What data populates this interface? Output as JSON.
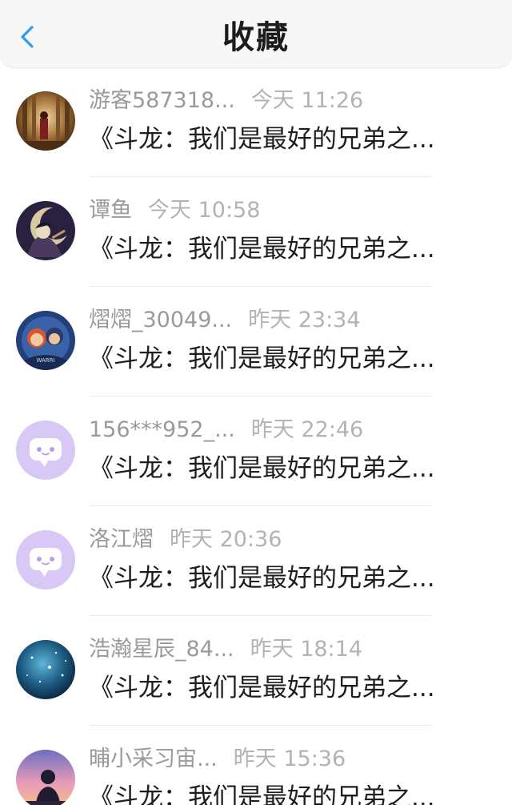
{
  "header": {
    "title": "收藏",
    "back_icon": "chevron-left-icon",
    "accent_color": "#2f9bf0"
  },
  "items": [
    {
      "username": "游客587318...",
      "time": "今天 11:26",
      "content": "《斗龙：我们是最好的兄弟之...",
      "avatar": "temple-scene-avatar"
    },
    {
      "username": "谭鱼",
      "time": "今天 10:58",
      "content": "《斗龙：我们是最好的兄弟之...",
      "avatar": "moon-character-avatar"
    },
    {
      "username": "熠熠_30049...",
      "time": "昨天 23:34",
      "content": "《斗龙：我们是最好的兄弟之...",
      "avatar": "warriors-avatar"
    },
    {
      "username": "156***952_...",
      "time": "昨天 22:46",
      "content": "《斗龙：我们是最好的兄弟之...",
      "avatar": "default-chat-bubble-avatar"
    },
    {
      "username": "洛江熠",
      "time": "昨天 20:36",
      "content": "《斗龙：我们是最好的兄弟之...",
      "avatar": "default-chat-bubble-avatar"
    },
    {
      "username": "浩瀚星辰_84...",
      "time": "昨天 18:14",
      "content": "《斗龙：我们是最好的兄弟之...",
      "avatar": "starry-sky-avatar"
    },
    {
      "username": "晡小采习宙...",
      "time": "昨天 15:36",
      "content": "《斗龙：我们是最好的兄弟之...",
      "avatar": "sunset-silhouette-avatar"
    }
  ]
}
